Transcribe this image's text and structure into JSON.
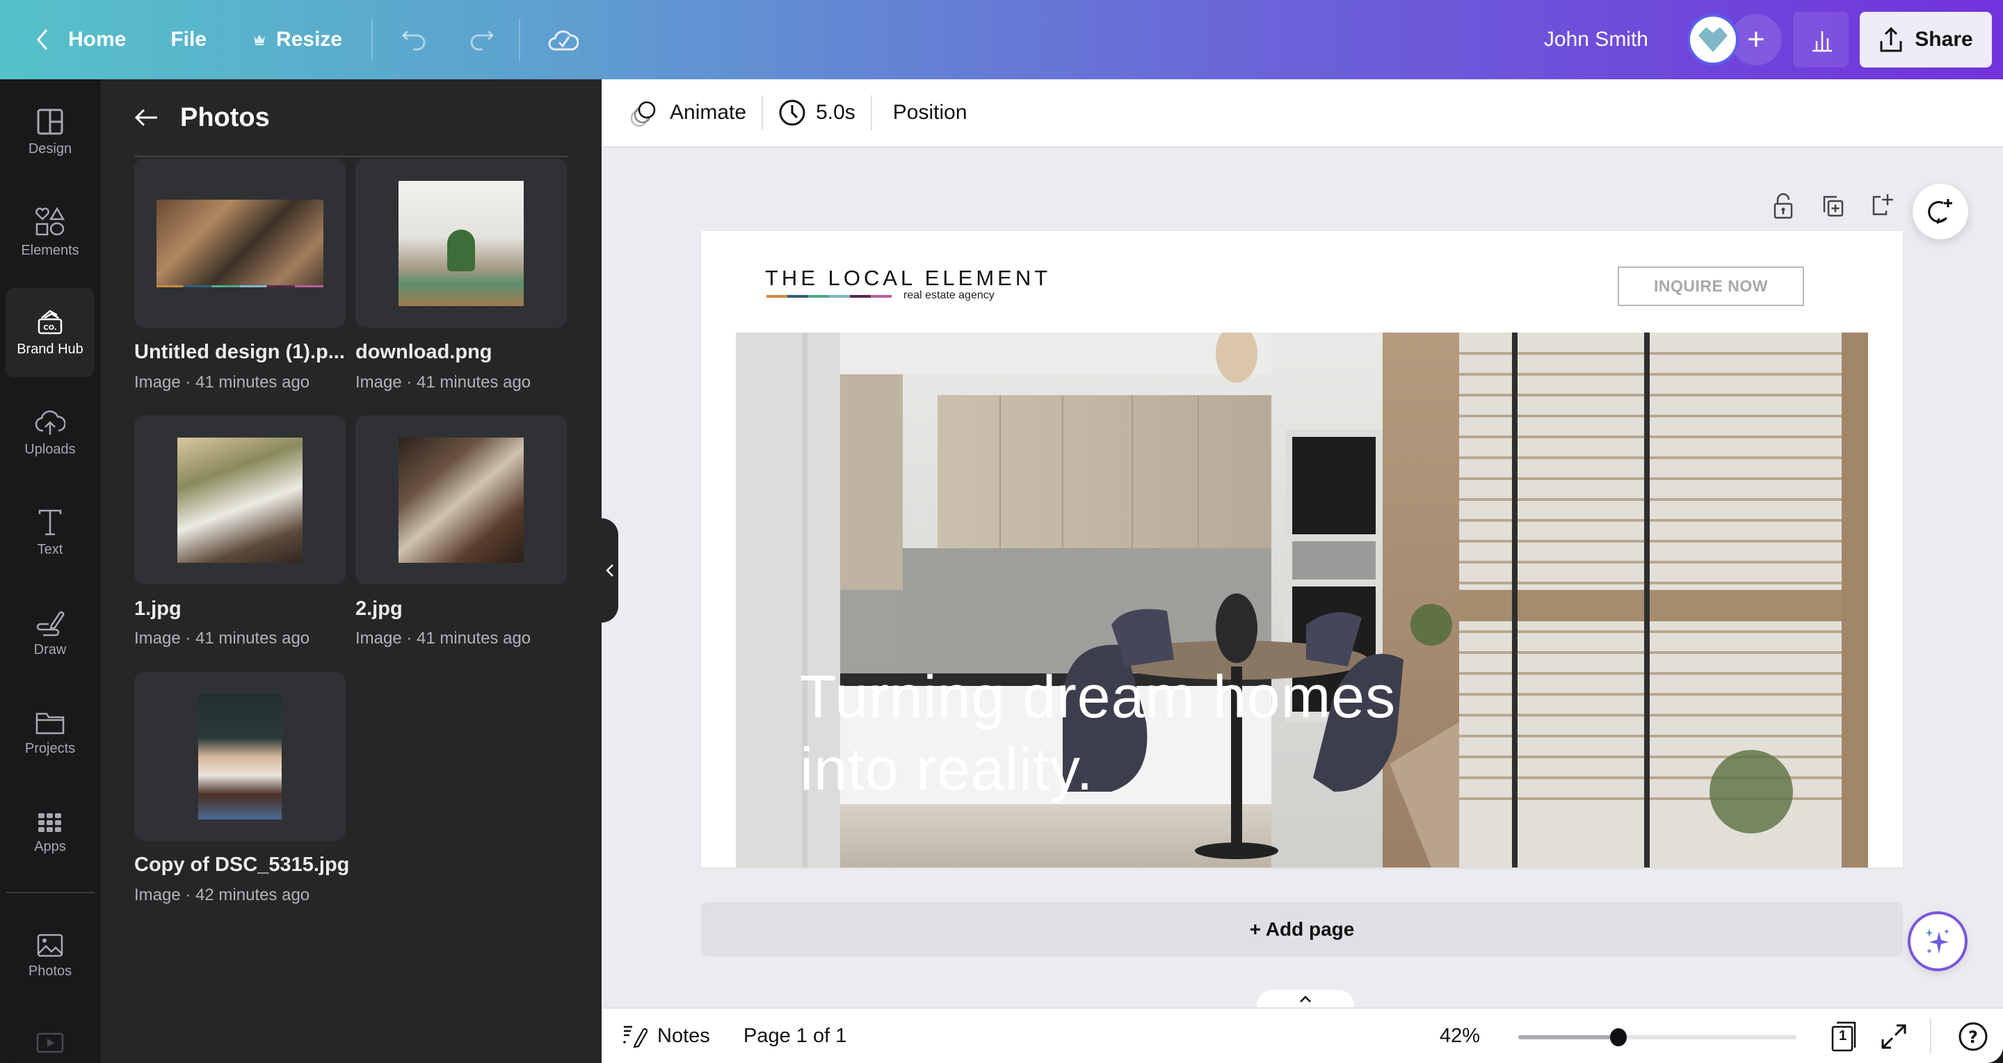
{
  "topbar": {
    "home_label": "Home",
    "file_label": "File",
    "resize_label": "Resize",
    "user_name": "John Smith",
    "share_label": "Share",
    "gradient_start": "#55c2c9",
    "gradient_end": "#7232dc"
  },
  "rail": {
    "items": [
      {
        "label": "Design",
        "icon": "layout-icon"
      },
      {
        "label": "Elements",
        "icon": "shapes-icon"
      },
      {
        "label": "Brand Hub",
        "icon": "brand-icon",
        "active": true
      },
      {
        "label": "Uploads",
        "icon": "cloud-upload-icon"
      },
      {
        "label": "Text",
        "icon": "text-icon"
      },
      {
        "label": "Draw",
        "icon": "pen-icon"
      },
      {
        "label": "Projects",
        "icon": "folder-icon"
      },
      {
        "label": "Apps",
        "icon": "apps-grid-icon"
      },
      {
        "label": "Photos",
        "icon": "image-icon"
      }
    ]
  },
  "panel": {
    "title": "Photos",
    "files": [
      {
        "name": "Untitled design (1).p...",
        "meta": "Image · 41 minutes ago"
      },
      {
        "name": "download.png",
        "meta": "Image · 41 minutes ago"
      },
      {
        "name": "1.jpg",
        "meta": "Image · 41 minutes ago"
      },
      {
        "name": "2.jpg",
        "meta": "Image · 41 minutes ago"
      },
      {
        "name": "Copy of DSC_5315.jpg",
        "meta": "Image · 42 minutes ago"
      }
    ]
  },
  "context_bar": {
    "animate_label": "Animate",
    "duration_label": "5.0s",
    "position_label": "Position"
  },
  "design": {
    "brand_name": "THE LOCAL ELEMENT",
    "brand_tagline": "real estate agency",
    "brand_colors": [
      "#d08a3f",
      "#2e5f7a",
      "#4fa98a",
      "#7fb7cf",
      "#5a2a4a",
      "#b861a0"
    ],
    "cta_label": "INQUIRE NOW",
    "headline_line1": "Turning dream homes",
    "headline_line2": "into reality."
  },
  "canvas": {
    "add_page_label": "+ Add page"
  },
  "footer": {
    "notes_label": "Notes",
    "page_indicator": "Page 1 of 1",
    "zoom_label": "42%",
    "zoom_fraction": 0.36,
    "page_count": "1"
  }
}
